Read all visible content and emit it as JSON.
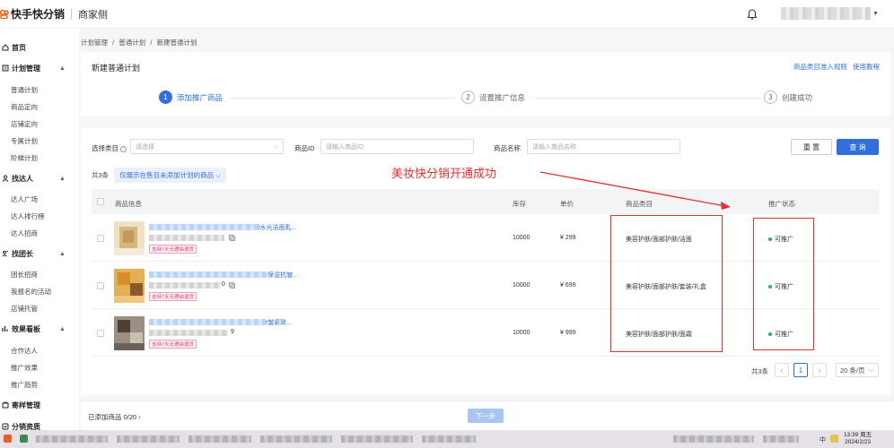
{
  "app": {
    "name": "快手快分销",
    "subtitle": "商家侧"
  },
  "sidebar": {
    "groups": [
      {
        "label": "首页",
        "items": []
      },
      {
        "label": "计划管理",
        "items": [
          "普通计划",
          "商品定向",
          "店铺定向",
          "专属计划",
          "阶梯计划"
        ]
      },
      {
        "label": "找达人",
        "items": [
          "达人广场",
          "达人排行榜",
          "达人招商"
        ]
      },
      {
        "label": "找团长",
        "items": [
          "团长招商",
          "我报名的活动",
          "店铺托管"
        ]
      },
      {
        "label": "效果看板",
        "items": [
          "合作达人",
          "推广效果",
          "推广趋势"
        ]
      },
      {
        "label": "寄样管理",
        "items": []
      },
      {
        "label": "分销资质",
        "items": []
      }
    ]
  },
  "breadcrumb": [
    "计划管理",
    "/",
    "普通计划",
    "/",
    "新建普通计划"
  ],
  "page": {
    "title": "新建普通计划",
    "links": [
      "商品类目准入规则",
      "使用教程"
    ]
  },
  "steps": [
    {
      "num": "1",
      "label": "添加推广商品"
    },
    {
      "num": "2",
      "label": "设置推广信息"
    },
    {
      "num": "3",
      "label": "创建成功"
    }
  ],
  "filters": {
    "category_label": "选择类目",
    "category_placeholder": "请选择",
    "id_label": "商品ID",
    "id_placeholder": "请输入商品ID",
    "name_label": "商品名称",
    "name_placeholder": "请输入商品名称",
    "reset": "重 置",
    "query": "查 询"
  },
  "list": {
    "count": "共3条",
    "filter_tag": "仅展示在售且未添加计划的商品"
  },
  "annotation": "美妆快分销开通成功",
  "table": {
    "headers": [
      "商品信息",
      "库存",
      "单价",
      "商品类目",
      "推广状态"
    ],
    "rows": [
      {
        "name_suffix": "l水光洁面乳...",
        "badge": "支持7天无理由退货",
        "stock": "10000",
        "price": "¥ 299",
        "category": "美容护肤/面部护肤/洁面",
        "status": "可推广",
        "id_tail": ""
      },
      {
        "name_suffix": "保湿抗皱...",
        "badge": "支持7天无理由退货",
        "stock": "10000",
        "price": "¥ 699",
        "category": "美容护肤/面部护肤/套装/礼盒",
        "status": "可推广",
        "id_tail": "0"
      },
      {
        "name_suffix": "t皱紧致...",
        "badge": "支持7天无理由退货",
        "stock": "10000",
        "price": "¥ 999",
        "category": "美容护肤/面部护肤/面霜",
        "status": "可推广",
        "id_tail": "9"
      }
    ]
  },
  "pagination": {
    "total": "共3条",
    "current": "1",
    "size": "20 条/页"
  },
  "footer": {
    "added": "已添加商品 0/20",
    "next": "下一步"
  },
  "taskbar": {
    "time": "13:39 周五",
    "date": "2024/2/23",
    "lang": "中"
  }
}
